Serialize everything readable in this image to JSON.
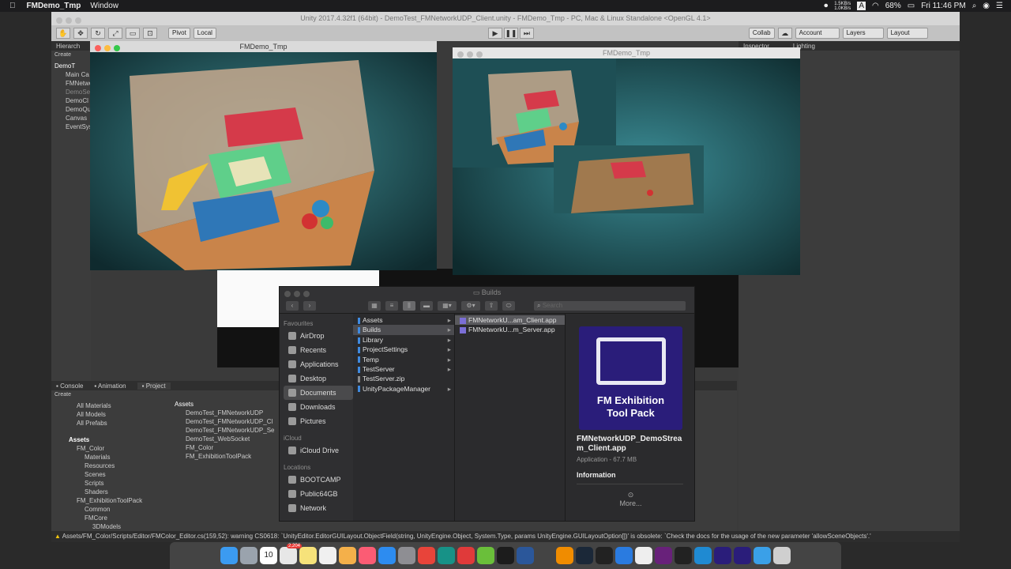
{
  "menubar": {
    "app": "FMDemo_Tmp",
    "window": "Window",
    "net_up": "1.5KB/s",
    "net_down": "1.0KB/s",
    "battery": "68%",
    "clock": "Fri 11:46 PM",
    "input": "A"
  },
  "unity": {
    "title": "Unity 2017.4.32f1 (64bit) - DemoTest_FMNetworkUDP_Client.unity - FMDemo_Tmp - PC, Mac & Linux Standalone <OpenGL 4.1>",
    "pivot": "Pivot",
    "local": "Local",
    "collab": "Collab",
    "account": "Account",
    "layers": "Layers",
    "layout": "Layout",
    "hierarchy_tab": "Hierarch",
    "create": "Create",
    "inspector_tab": "Inspector",
    "lighting_tab": "Lighting",
    "hierarchy_items": [
      "DemoT",
      "Main Ca",
      "FMNetwo",
      "DemoSe",
      "DemoCl",
      "DemoQu",
      "Canvas",
      "EventSys"
    ],
    "console_tab": "Console",
    "animation_tab": "Animation",
    "project_tab": "Project",
    "project_create": "Create",
    "favorites": [
      "All Materials",
      "All Models",
      "All Prefabs"
    ],
    "assets_label": "Assets",
    "assets_tree": [
      "Assets",
      "FM_Color",
      "Materials",
      "Resources",
      "Scenes",
      "Scripts",
      "Shaders",
      "FM_ExhibitionToolPack",
      "Common",
      "FMCore",
      "3DModels"
    ],
    "assets_header": "Assets",
    "assets_files": [
      "DemoTest_FMNetworkUDP",
      "DemoTest_FMNetworkUDP_Cl",
      "DemoTest_FMNetworkUDP_Se",
      "DemoTest_WebSocket",
      "FM_Color",
      "FM_ExhibitionToolPack"
    ],
    "warning": "Assets/FM_Color/Scripts/Editor/FMColor_Editor.cs(159,52): warning CS0618: `UnityEditor.EditorGUILayout.ObjectField(string, UnityEngine.Object, System.Type, params UnityEngine.GUILayoutOption[])' is obsolete: `Check the docs for the usage of the new parameter 'allowSceneObjects'.'"
  },
  "game_windows": [
    {
      "title": "FMDemo_Tmp"
    },
    {
      "title": "FMDemo_Tmp"
    }
  ],
  "finder": {
    "title": "Builds",
    "search_placeholder": "Search",
    "favourites_label": "Favourites",
    "favourites": [
      {
        "label": "AirDrop",
        "icon": "airdrop-icon"
      },
      {
        "label": "Recents",
        "icon": "recents-icon"
      },
      {
        "label": "Applications",
        "icon": "applications-icon"
      },
      {
        "label": "Desktop",
        "icon": "desktop-icon"
      },
      {
        "label": "Documents",
        "icon": "documents-icon"
      },
      {
        "label": "Downloads",
        "icon": "downloads-icon"
      },
      {
        "label": "Pictures",
        "icon": "pictures-icon"
      }
    ],
    "icloud_label": "iCloud",
    "icloud": [
      {
        "label": "iCloud Drive",
        "icon": "cloud-icon"
      }
    ],
    "locations_label": "Locations",
    "locations": [
      {
        "label": "BOOTCAMP",
        "icon": "disk-icon"
      },
      {
        "label": "Public64GB",
        "icon": "disk-icon"
      },
      {
        "label": "Network",
        "icon": "network-icon"
      }
    ],
    "column1": [
      "Assets",
      "Builds",
      "Library",
      "ProjectSettings",
      "Temp",
      "TestServer",
      "TestServer.zip",
      "UnityPackageManager"
    ],
    "column2": [
      "FMNetworkU...am_Client.app",
      "FMNetworkU...m_Server.app"
    ],
    "preview_title_line1": "FM Exhibition",
    "preview_title_line2": "Tool Pack",
    "preview_name": "FMNetworkUDP_DemoStream_Client.app",
    "preview_kind": "Application - 67.7 MB",
    "information": "Information",
    "more": "More..."
  },
  "dock_badges": {
    "calendar_day": "10",
    "mail_count": "2,204"
  }
}
